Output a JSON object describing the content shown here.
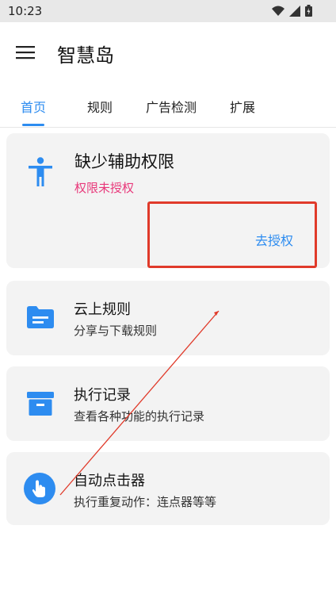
{
  "status": {
    "time": "10:23"
  },
  "app": {
    "title": "智慧岛"
  },
  "tabs": [
    {
      "label": "首页",
      "active": true
    },
    {
      "label": "规则",
      "active": false
    },
    {
      "label": "广告检测",
      "active": false
    },
    {
      "label": "扩展",
      "active": false
    }
  ],
  "permission_card": {
    "title": "缺少辅助权限",
    "subtitle": "权限未授权",
    "action": "去授权"
  },
  "cards": [
    {
      "title": "云上规则",
      "subtitle": "分享与下载规则",
      "icon": "folder-icon"
    },
    {
      "title": "执行记录",
      "subtitle": "查看各种功能的执行记录",
      "icon": "archive-icon"
    },
    {
      "title": "自动点击器",
      "subtitle": "执行重复动作：连点器等等",
      "icon": "touch-icon"
    }
  ],
  "colors": {
    "accent": "#2d8cf0",
    "warning": "#e8387a",
    "highlight": "#e03a2a"
  }
}
